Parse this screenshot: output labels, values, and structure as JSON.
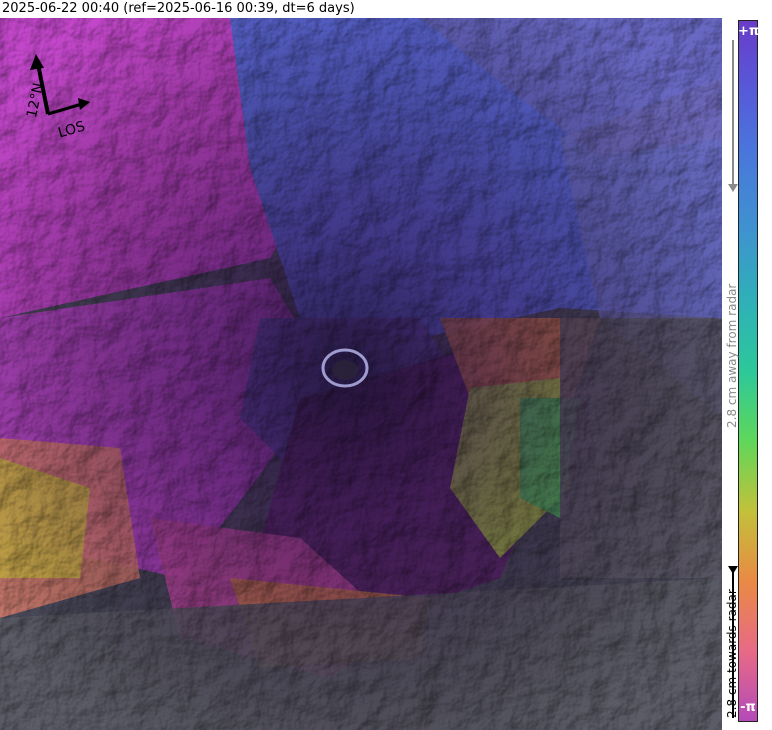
{
  "header": {
    "title": "2025-06-22 00:40 (ref=2025-06-16 00:39, dt=6 days)"
  },
  "compass": {
    "north_label": "12°N",
    "los_label": "LOS"
  },
  "colorbar": {
    "top_symbol": "+π",
    "bottom_symbol": "-π",
    "away_label": "2.8 cm away from radar",
    "towards_label": "2.8 cm towards radar",
    "colors": [
      "#6a3cc8",
      "#4a74dc",
      "#2fb0b8",
      "#5fd75a",
      "#c2c13a",
      "#e98a44",
      "#e86a86",
      "#b44ab8"
    ]
  }
}
